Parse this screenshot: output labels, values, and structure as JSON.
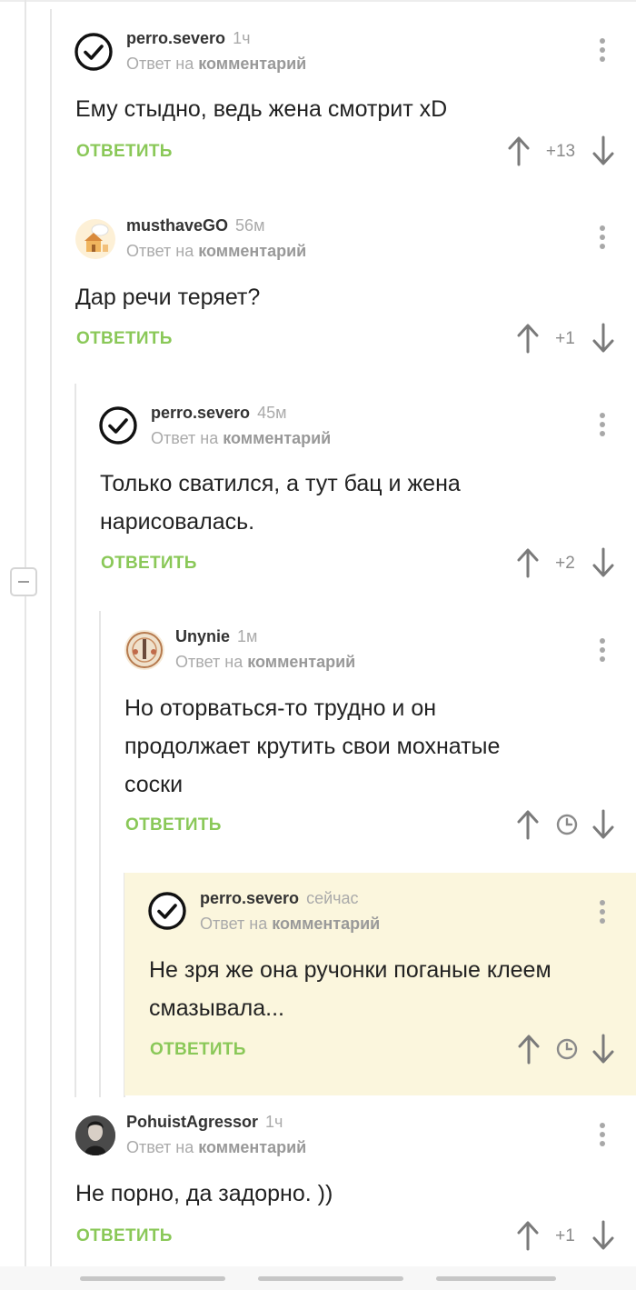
{
  "thread": {
    "reply_prefix": "Ответ на",
    "reply_target": "комментарий",
    "reply_label": "ОТВЕТИТЬ"
  },
  "comments": [
    {
      "user": "perro.severo",
      "time": "1ч",
      "avatar": "checkmark-circle-avatar",
      "text": "Ему стыдно, ведь жена смотрит xD",
      "rating": "+13"
    },
    {
      "user": "musthaveGO",
      "time": "56м",
      "avatar": "house-cartoon-avatar",
      "text": "Дар речи теряет?",
      "rating": "+1"
    },
    {
      "user": "perro.severo",
      "time": "45м",
      "avatar": "checkmark-circle-avatar",
      "text": "Только сватился, а тут бац и жена нарисовалась.",
      "rating": "+2"
    },
    {
      "user": "Unynie",
      "time": "1м",
      "avatar": "circular-emblem-avatar",
      "text": "Но оторваться-то трудно и он продолжает крутить свои мохнатые соски",
      "rating": "",
      "rating_icon": "clock-icon"
    },
    {
      "user": "perro.severo",
      "time": "сейчас",
      "avatar": "checkmark-circle-avatar",
      "text": "Не зря же она ручонки поганые клеем смазывала...",
      "rating": "",
      "rating_icon": "clock-icon",
      "highlight_color": "#fbf6dd"
    },
    {
      "user": "PohuistAgressor",
      "time": "1ч",
      "avatar": "person-photo-avatar",
      "text": "Не порно, да задорно. ))",
      "rating": "+1"
    }
  ],
  "colors": {
    "accent_green": "#8ac858",
    "muted": "#aaaaaa",
    "highlight": "#fbf6dd"
  }
}
